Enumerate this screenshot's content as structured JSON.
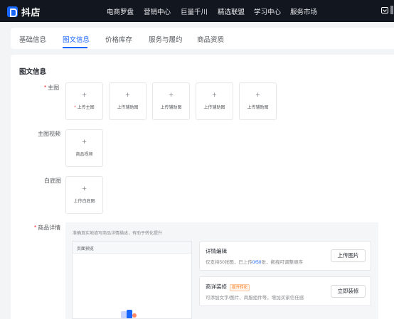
{
  "app": {
    "name": "抖店"
  },
  "nav": [
    {
      "label": "电商罗盘"
    },
    {
      "label": "营销中心"
    },
    {
      "label": "巨量千川"
    },
    {
      "label": "精选联盟"
    },
    {
      "label": "学习中心"
    },
    {
      "label": "服务市场"
    }
  ],
  "tabs": [
    {
      "label": "基础信息",
      "active": false
    },
    {
      "label": "图文信息",
      "active": true
    },
    {
      "label": "价格库存",
      "active": false
    },
    {
      "label": "服务与履约",
      "active": false
    },
    {
      "label": "商品资质",
      "active": false
    }
  ],
  "section": {
    "title": "图文信息"
  },
  "fields": {
    "main_image": {
      "label": "主图",
      "required": true,
      "slots": [
        {
          "label": "上传主图",
          "required": true
        },
        {
          "label": "上传辅助图"
        },
        {
          "label": "上传辅助图"
        },
        {
          "label": "上传辅助图"
        },
        {
          "label": "上传辅助图"
        }
      ]
    },
    "main_video": {
      "label": "主图视频",
      "slot_label": "商品视频"
    },
    "white_bg": {
      "label": "白底图",
      "slot_label": "上传白底图"
    },
    "detail": {
      "label": "商品详情",
      "required": true,
      "hint": "准确真实地填写商品详情描述，有助于转化提升",
      "preview_title": "页面预览",
      "edit_card": {
        "title": "详情编辑",
        "desc_prefix": "仅支持50张图，已上传",
        "desc_count": "0/50",
        "desc_suffix": "张，拖拽可调整顺序",
        "button": "上传图片"
      },
      "decor_card": {
        "title": "商详装修",
        "tag": "提升转化",
        "desc": "可添加文字/图片、商服组件等，增加买家信任感",
        "button": "立即装修"
      }
    }
  },
  "plus_glyph": "+",
  "colors": {
    "accent": "#1966ff",
    "topbar": "#12161e",
    "required": "#f5222d",
    "tag": "#ff7a1a"
  }
}
